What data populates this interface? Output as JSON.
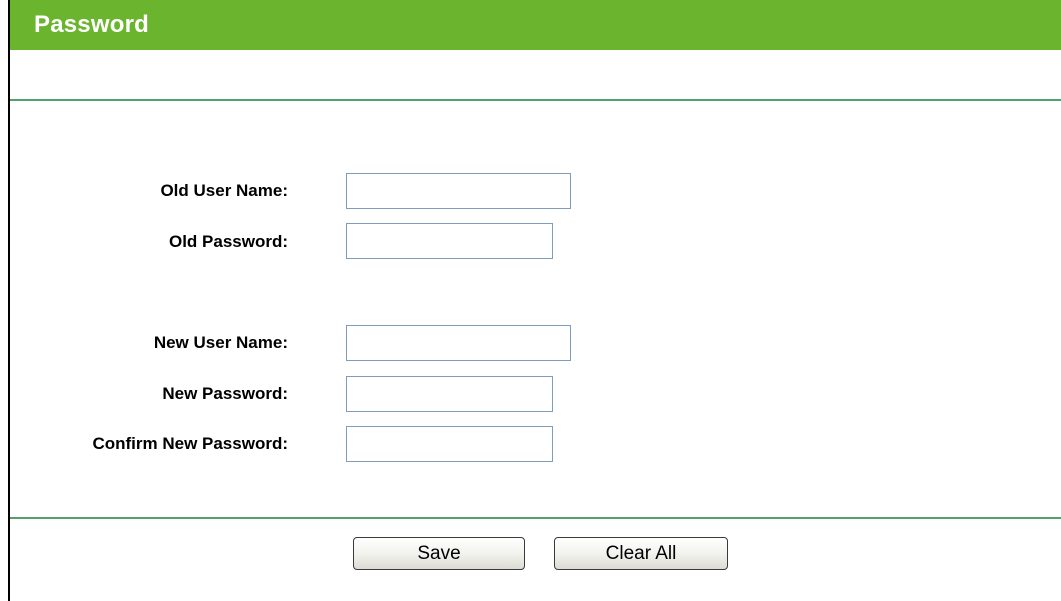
{
  "header": {
    "title": "Password"
  },
  "form": {
    "old_user_name_label": "Old User Name:",
    "old_user_name_value": "",
    "old_password_label": "Old Password:",
    "old_password_value": "",
    "new_user_name_label": "New User Name:",
    "new_user_name_value": "",
    "new_password_label": "New Password:",
    "new_password_value": "",
    "confirm_new_password_label": "Confirm New Password:",
    "confirm_new_password_value": ""
  },
  "actions": {
    "save_label": "Save",
    "clear_all_label": "Clear All"
  },
  "colors": {
    "header_green": "#6ab42e",
    "divider_green": "#53a06a",
    "input_border": "#7f9db9"
  }
}
